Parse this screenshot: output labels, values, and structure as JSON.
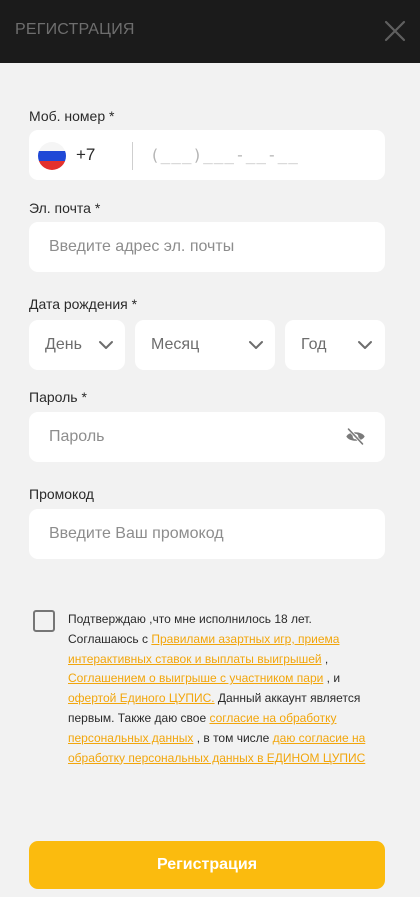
{
  "header": {
    "title": "РЕГИСТРАЦИЯ",
    "close_icon": "close-icon"
  },
  "phone": {
    "label": "Моб. номер *",
    "country_code": "+7",
    "flag_icon": "russia-flag-icon",
    "mask": "(___)___-__-__"
  },
  "email": {
    "label": "Эл. почта *",
    "placeholder": "Введите адрес эл. почты"
  },
  "birth_date": {
    "label": "Дата рождения *",
    "day": "День",
    "month": "Месяц",
    "year": "Год",
    "chevron_icon": "chevron-down-icon"
  },
  "password": {
    "label": "Пароль *",
    "placeholder": "Пароль",
    "eye_icon": "eye-off-icon"
  },
  "promo": {
    "label": "Промокод",
    "placeholder": "Введите Ваш промокод"
  },
  "consent": {
    "text_1": "Подтверждаю ,что мне исполнилось 18 лет. Соглашаюсь с ",
    "link_rules": "Правилами азартных игр, приема интерактивных ставок и выплаты выигрышей",
    "text_2": " , ",
    "link_agreement": "Соглашением о выигрыше с участником пари",
    "text_3": " , и ",
    "link_offer": "офертой Единого ЦУПИС.",
    "text_4": " Данный аккаунт является первым. Также даю свое ",
    "link_personal_data": "согласие на обработку персональных данных",
    "text_5": " , в том числе ",
    "link_personal_data_cupis": "даю согласие на обработку персональных данных в ЕДИНОМ ЦУПИС"
  },
  "submit": {
    "label": "Регистрация"
  },
  "colors": {
    "accent": "#fbbb0e",
    "link": "#f2a60c",
    "header_bg": "#1b1b1b",
    "page_bg": "#f2f2f2"
  }
}
